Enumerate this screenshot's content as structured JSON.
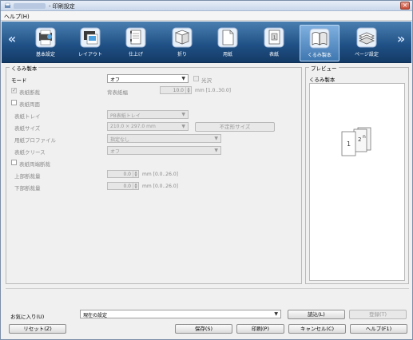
{
  "window": {
    "title": "- 印刷設定",
    "close_label": "×"
  },
  "menu": {
    "help": "ヘルプ(H)"
  },
  "nav": {
    "left_arrow": "«",
    "right_arrow": "»",
    "categories": [
      {
        "label": "基本設定",
        "icon": "basic-settings-icon"
      },
      {
        "label": "レイアウト",
        "icon": "layout-icon"
      },
      {
        "label": "仕上げ",
        "icon": "finishing-icon"
      },
      {
        "label": "折り",
        "icon": "fold-icon"
      },
      {
        "label": "用紙",
        "icon": "paper-icon"
      },
      {
        "label": "表紙",
        "icon": "cover-icon"
      },
      {
        "label": "くるみ製本",
        "icon": "perfect-binding-icon",
        "selected": true
      },
      {
        "label": "ページ設定",
        "icon": "page-settings-icon"
      }
    ]
  },
  "binding": {
    "group_title": "くるみ製本",
    "mode_label": "モード",
    "mode_value": "オフ",
    "gloss_label": "光沢",
    "cover_trim_label": "表紙断裁",
    "spine_width_label": "背表紙幅",
    "spine_width_value": "10.0",
    "spine_width_range": "mm [1.0..30.0]",
    "cover_both_sides_label": "表紙両面",
    "cover_tray_label": "表紙トレイ",
    "cover_tray_value": "PB表紙トレイ",
    "cover_size_label": "表紙サイズ",
    "cover_size_value": "210.0 × 297.0 mm",
    "custom_size_button": "不定形サイズ",
    "paper_profile_label": "用紙プロファイル",
    "paper_profile_value": "指定なし",
    "cover_crease_label": "表紙クリース",
    "cover_crease_value": "オフ",
    "cover_both_ends_trim_label": "表紙両端断裁",
    "top_trim_label": "上部断裁量",
    "top_trim_value": "0.0",
    "top_trim_range": "mm [0.0..26.0]",
    "bottom_trim_label": "下部断裁量",
    "bottom_trim_value": "0.0",
    "bottom_trim_range": "mm [0.0..26.0]"
  },
  "preview": {
    "group_title": "プレビュー",
    "subtitle": "くるみ製本",
    "page_numbers": [
      "1",
      "2",
      "n"
    ]
  },
  "favorites": {
    "label": "お気に入り(U)",
    "value": "現在の設定",
    "load_button": "読込(L)",
    "register_button": "登録(T)"
  },
  "footer": {
    "reset_button": "リセット(Z)",
    "save_button": "保存(S)",
    "print_button": "印刷(P)",
    "cancel_button": "キャンセル(C)",
    "help_button": "ヘルプ(F1)"
  },
  "colors": {
    "nav_background": "#1f4f84",
    "selected_tab": "#3f77b0",
    "disabled_text": "#8a8a8a"
  }
}
